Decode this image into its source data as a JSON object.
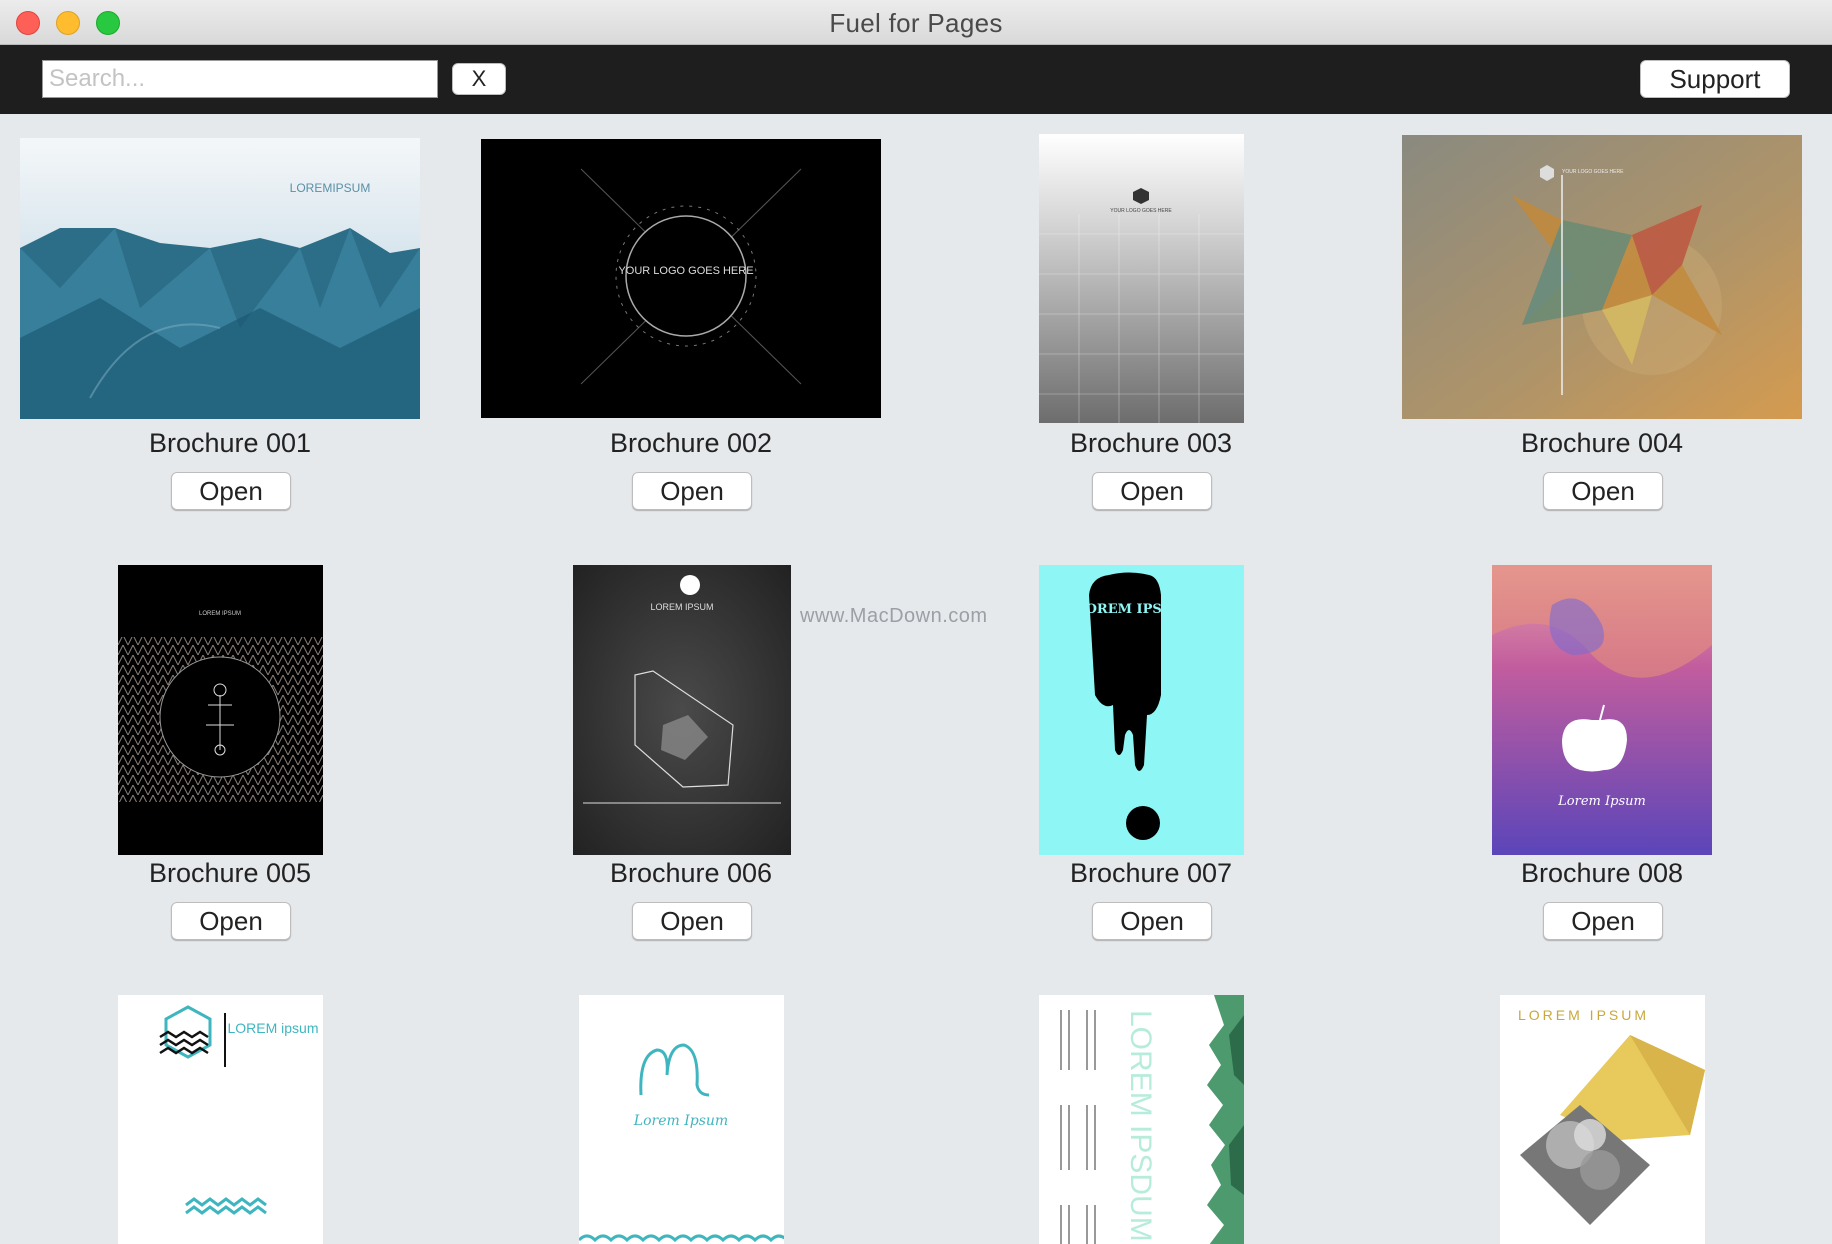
{
  "window": {
    "title": "Fuel for Pages"
  },
  "toolbar": {
    "search_placeholder": "Search...",
    "clear_label": "X",
    "support_label": "Support"
  },
  "watermark": "www.MacDown.com",
  "items": [
    {
      "name": "Brochure 001",
      "open_label": "Open",
      "thumb_text": "LOREMIPSUM"
    },
    {
      "name": "Brochure 002",
      "open_label": "Open",
      "thumb_text": "YOUR LOGO GOES HERE"
    },
    {
      "name": "Brochure 003",
      "open_label": "Open",
      "thumb_text": "YOUR LOGO GOES HERE"
    },
    {
      "name": "Brochure 004",
      "open_label": "Open",
      "thumb_text": "YOUR LOGO GOES HERE"
    },
    {
      "name": "Brochure 005",
      "open_label": "Open",
      "thumb_text": "LOREM IPSUM"
    },
    {
      "name": "Brochure 006",
      "open_label": "Open",
      "thumb_text": "LOREM IPSUM"
    },
    {
      "name": "Brochure 007",
      "open_label": "Open",
      "thumb_text": "LOREM IPSUM"
    },
    {
      "name": "Brochure 008",
      "open_label": "Open",
      "thumb_text": "Lorem Ipsum"
    },
    {
      "name": "",
      "open_label": "",
      "thumb_text": "LOREM ipsum"
    },
    {
      "name": "",
      "open_label": "",
      "thumb_text": "Lorem Ipsum"
    },
    {
      "name": "",
      "open_label": "",
      "thumb_text": "LOREM IPSDUM"
    },
    {
      "name": "",
      "open_label": "",
      "thumb_text": "LOREM IPSUM"
    }
  ]
}
